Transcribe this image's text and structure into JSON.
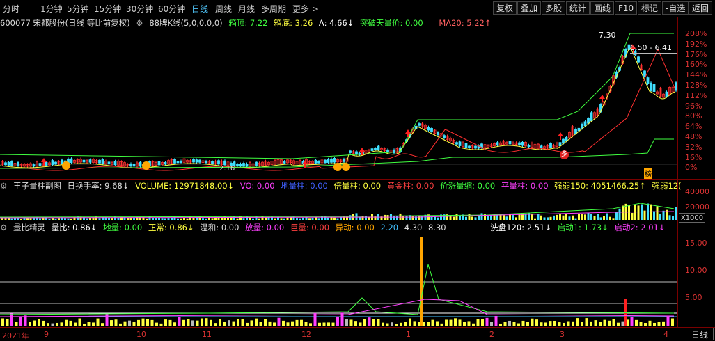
{
  "toolbar": {
    "timeframes": [
      "分时",
      "1分钟",
      "5分钟",
      "15分钟",
      "30分钟",
      "60分钟",
      "日线",
      "周线",
      "月线",
      "多周期",
      "更多 >"
    ],
    "active_timeframe": "日线",
    "right_buttons": [
      "复权",
      "叠加",
      "多股",
      "统计",
      "画线",
      "F10",
      "标记",
      "-自选",
      "返回"
    ]
  },
  "main_header": {
    "stock": "600077 宋都股份(日线 等比前复权)",
    "gear": "⚙",
    "indicator": "88牌K线(5,0,0,0,0)",
    "box_top": "箱顶: 7.22",
    "box_bottom": "箱底: 3.26",
    "a_value": "A: 4.66↓",
    "breakout": "突破天量价: 0.00",
    "ma20": "MA20: 5.22↑"
  },
  "main_chart": {
    "y_labels": [
      "208%",
      "192%",
      "176%",
      "160%",
      "144%",
      "128%",
      "112%",
      "96%",
      "80%",
      "64%",
      "48%",
      "32%",
      "16%",
      "0%"
    ],
    "high_label": "7.30",
    "range_label": "6.50 - 6.41",
    "low_label": "2.16",
    "badge": "榜",
    "marker": "多"
  },
  "sub1_header": {
    "name": "王子量柱副图",
    "turnover": "日换手率: 9.68↓",
    "volume": "VOLUME: 12971848.00↓",
    "vo": "VO: 0.00",
    "low_vol": "地量柱: 0.00",
    "double_vol": "倍量柱: 0.00",
    "gold_vol": "黄金柱: 0.00",
    "price_vol": "价涨量缩: 0.00",
    "flat_vol": "平量柱: 0.00",
    "strength150": "强弱150: 4051466.25↑",
    "strength120": "强弱12("
  },
  "sub1_chart": {
    "y_labels": [
      "40000",
      "20000"
    ],
    "unit": "X1000"
  },
  "sub2_header": {
    "name": "量比精灵",
    "ratio": "量比: 0.86↓",
    "low": "地量: 0.00",
    "normal": "正常: 0.86↓",
    "mild": "温和: 0.00",
    "release": "放量: 0.00",
    "huge": "巨量: 0.00",
    "abnormal": "异动: 0.00",
    "lv1": "2.20",
    "lv2": "4.30",
    "lv3": "8.30",
    "wash": "洗盘120: 2.51↓",
    "start1": "启动1: 1.73↓",
    "start2": "启动2: 2.01↓"
  },
  "sub2_chart": {
    "y_labels": [
      "15.00",
      "10.00",
      "5.00"
    ]
  },
  "x_axis": {
    "labels": [
      "2021年",
      "9",
      "10",
      "11",
      "12",
      "1",
      "2",
      "3",
      "4"
    ],
    "period_button": "日线"
  },
  "colors": {
    "up": "#ff3030",
    "down": "#40e0ff",
    "yellow": "#ffff40",
    "green": "#40ff40",
    "magenta": "#ff40ff",
    "orange": "#ffa500"
  }
}
